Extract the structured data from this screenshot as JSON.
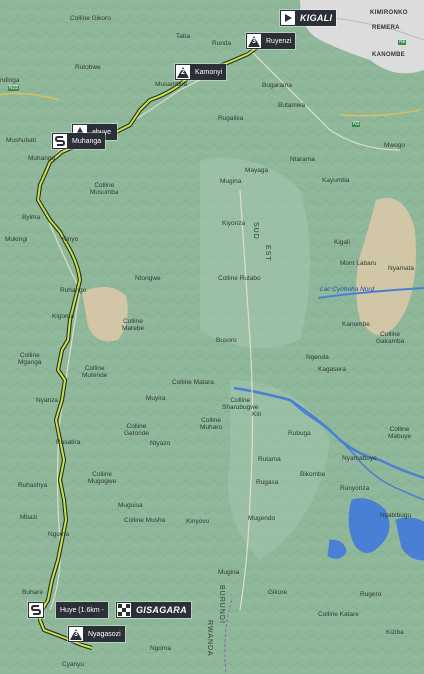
{
  "route": {
    "start": "KIGALI",
    "finish": "GISAGARA",
    "kom": [
      {
        "category": "3",
        "name": "Ruyenzi"
      },
      {
        "category": "2",
        "name": "Kamonyi"
      },
      {
        "category": "3",
        "name": "Nyagasozi"
      }
    ],
    "sprint": {
      "name": "Muhanga"
    },
    "sprint_secondary": "abuye",
    "finish_detail": "Huye (1.6km -"
  },
  "places": {
    "collines_gikoro": "Colline Gikoro",
    "kimironko": "KIMIRONKO",
    "remera": "REMERA",
    "kanombe": "KANOMBE",
    "taba": "Taba",
    "runda": "Runda",
    "rutobwe": "Rutobwe",
    "ndinga": "ndinga",
    "musambira": "Musambira",
    "bugarama": "Bugarama",
    "butamwa": "Butamwa",
    "rugalika": "Rugalika",
    "mwogo": "Mwogo",
    "mushubati": "Mushubati",
    "mushishiro": "Mushishiro",
    "muhanga_small": "Muhanga",
    "ntarama": "Ntarama",
    "kayumba": "Kayumba",
    "colline_musumba": "Colline\nMusumba",
    "mayaga": "Mayaga",
    "mugina": "Mugina",
    "byima": "Byima",
    "mukingi": "Mukingi",
    "kinyo": "Kinyo",
    "kiyonza": "Kiyonza",
    "kigali_label": "Kigali",
    "mont_labaru": "Mont Labaru",
    "nyamata": "Nyamata",
    "ntongwe": "Ntongwe",
    "colline_rutabo": "Colline Rutabo",
    "ruhango": "Ruhango",
    "kigoma": "Kigoma",
    "colline_marebe": "Colline\nMarebe",
    "lac_cyohoha": "Lac Cyohoha Nord",
    "kanombe2": "Kanombe",
    "colline_gakamba": "Colline\nGakamba",
    "busoro": "Busoro",
    "ngenda": "Ngenda",
    "kagasera": "Kagasera",
    "colline_mganga": "Colline\nMganga",
    "colline_mutende": "Colline\nMutende",
    "colline_matara": "Colline Matara",
    "colline_sharubugwe": "Colline\nSharubugwe",
    "kiri": "Kiri",
    "nyanza": "Nyanza",
    "muyira": "Muyira",
    "colline_gatonde": "Colline\nGatonde",
    "colline_muharo": "Colline\nMuharo",
    "rubuga": "Rubuga",
    "colline_mabuye": "Colline\nMabuye",
    "rutama": "Rutama",
    "ntyazo": "Ntyazo",
    "nyamabuye": "Nyamabuye",
    "rusatira": "Rusatira",
    "colline_mugogwe": "Colline\nMugogwe",
    "bikombe": "Bikombe",
    "ruhashya": "Ruhashya",
    "rugasa": "Rugasa",
    "runyonza": "Runyonza",
    "muguisa": "Muguisa",
    "mbazi": "Mbazi",
    "colline_musha": "Colline Musha",
    "kinyovu": "Kinyovu",
    "mugendo": "Mugendo",
    "nyabibugu": "Nyabibugu",
    "ngoma": "Ngoma",
    "buhare": "Buhare",
    "mugina2": "Mugina",
    "burundi": "BURUNDI",
    "rwanda": "RWANDA",
    "gikore": "Gikore",
    "rugero": "Rugero",
    "colline_katare": "Colline Katare",
    "kiziba": "Kiziba",
    "ngoma2": "Ngoma",
    "cyanyu": "Cyanyu",
    "sud": "SUD",
    "est": "EST",
    "n15": "N15",
    "n3": "N3",
    "n6": "N6"
  },
  "colors": {
    "terrain": "#8fb79a",
    "route": "#c9e04a",
    "water": "#4a7fd6",
    "urban": "#d9d9d9",
    "sand": "#d8c8a6"
  }
}
